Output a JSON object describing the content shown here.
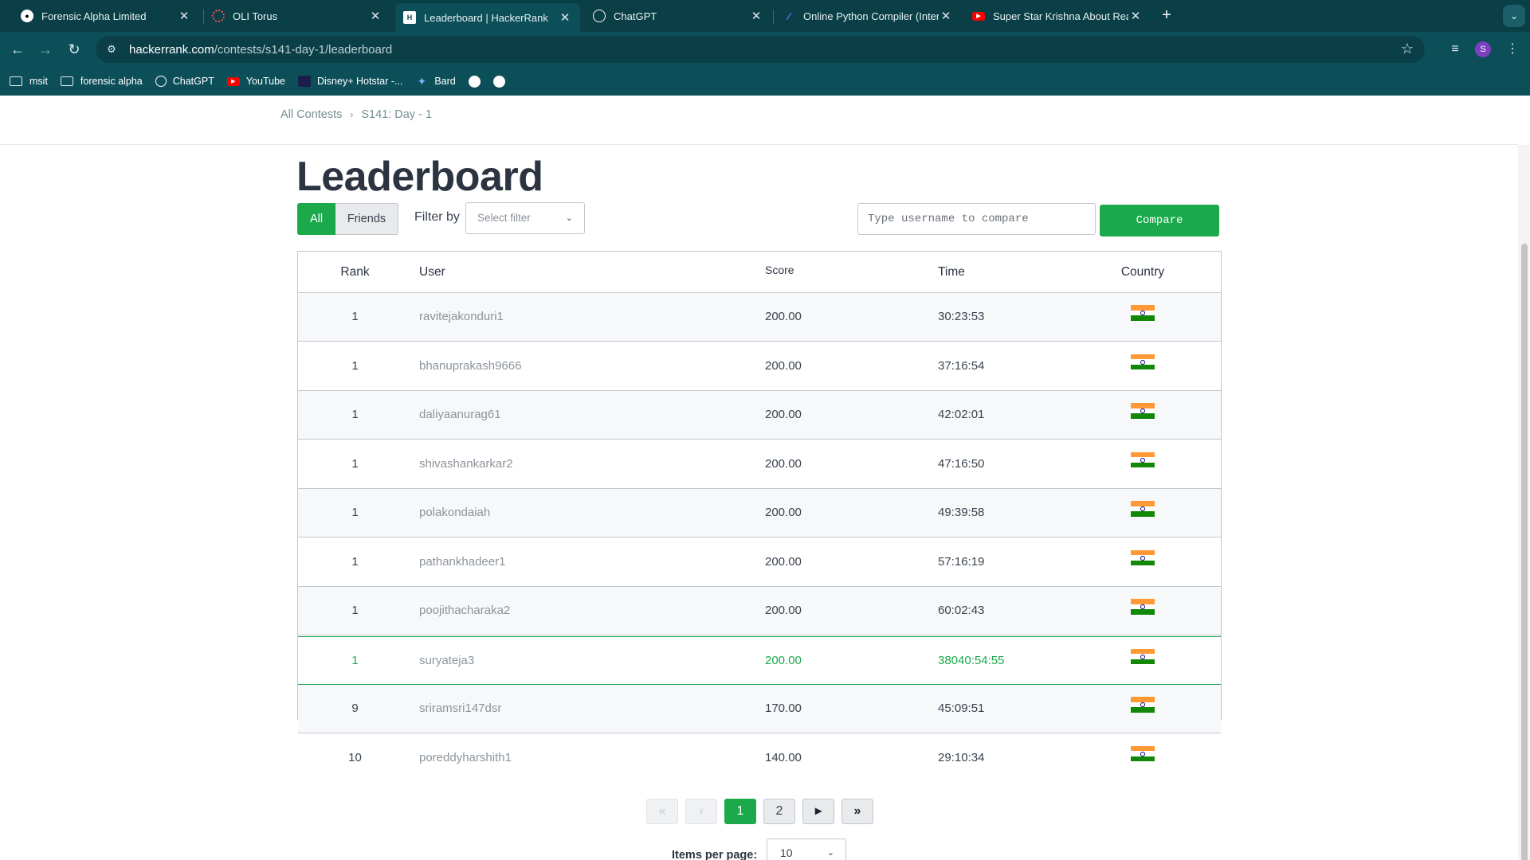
{
  "browser": {
    "tabs": [
      {
        "title": "Forensic Alpha Limited",
        "icon": "github-icon"
      },
      {
        "title": "OLI Torus",
        "icon": "torus-icon"
      },
      {
        "title": "Leaderboard | HackerRank",
        "icon": "hackerrank-icon"
      },
      {
        "title": "ChatGPT",
        "icon": "chatgpt-icon"
      },
      {
        "title": "Online Python Compiler (Inter",
        "icon": "python-compiler-icon"
      },
      {
        "title": "Super Star Krishna About Rea",
        "icon": "youtube-icon"
      }
    ],
    "active_tab": 2,
    "url_host": "hackerrank.com",
    "url_path": "/contests/s141-day-1/leaderboard",
    "profile_initial": "S",
    "bookmarks": [
      {
        "label": "msit",
        "icon": "folder-icon"
      },
      {
        "label": "forensic alpha",
        "icon": "folder-icon"
      },
      {
        "label": "ChatGPT",
        "icon": "chatgpt-icon"
      },
      {
        "label": "YouTube",
        "icon": "youtube-icon"
      },
      {
        "label": "Disney+ Hotstar -...",
        "icon": "hotstar-icon"
      },
      {
        "label": "Bard",
        "icon": "bard-icon"
      }
    ]
  },
  "breadcrumb": {
    "root": "All Contests",
    "current": "S141: Day - 1"
  },
  "page_title": "Leaderboard",
  "filters": {
    "all_label": "All",
    "friends_label": "Friends",
    "filter_by_label": "Filter by",
    "select_placeholder": "Select filter",
    "compare_placeholder": "Type username to compare",
    "compare_button": "Compare"
  },
  "table": {
    "headers": {
      "rank": "Rank",
      "user": "User",
      "score": "Score",
      "time": "Time",
      "country": "Country"
    },
    "rows": [
      {
        "rank": "1",
        "user": "ravitejakonduri1",
        "score": "200.00",
        "time": "30:23:53",
        "country": "India"
      },
      {
        "rank": "1",
        "user": "bhanuprakash9666",
        "score": "200.00",
        "time": "37:16:54",
        "country": "India"
      },
      {
        "rank": "1",
        "user": "daliyaanurag61",
        "score": "200.00",
        "time": "42:02:01",
        "country": "India"
      },
      {
        "rank": "1",
        "user": "shivashankarkar2",
        "score": "200.00",
        "time": "47:16:50",
        "country": "India"
      },
      {
        "rank": "1",
        "user": "polakondaiah",
        "score": "200.00",
        "time": "49:39:58",
        "country": "India"
      },
      {
        "rank": "1",
        "user": "pathankhadeer1",
        "score": "200.00",
        "time": "57:16:19",
        "country": "India"
      },
      {
        "rank": "1",
        "user": "poojithacharaka2",
        "score": "200.00",
        "time": "60:02:43",
        "country": "India"
      },
      {
        "rank": "1",
        "user": "suryateja3",
        "score": "200.00",
        "time": "38040:54:55",
        "country": "India"
      },
      {
        "rank": "9",
        "user": "sriramsri147dsr",
        "score": "170.00",
        "time": "45:09:51",
        "country": "India"
      },
      {
        "rank": "10",
        "user": "poreddyharshith1",
        "score": "140.00",
        "time": "29:10:34",
        "country": "India"
      }
    ],
    "highlighted_row": 7
  },
  "pagination": {
    "pages": [
      "1",
      "2"
    ],
    "current": "1"
  },
  "items_per_page": {
    "label": "Items per page:",
    "value": "10"
  },
  "colors": {
    "accent": "#1ba94c",
    "chrome": "#0d4f59"
  }
}
